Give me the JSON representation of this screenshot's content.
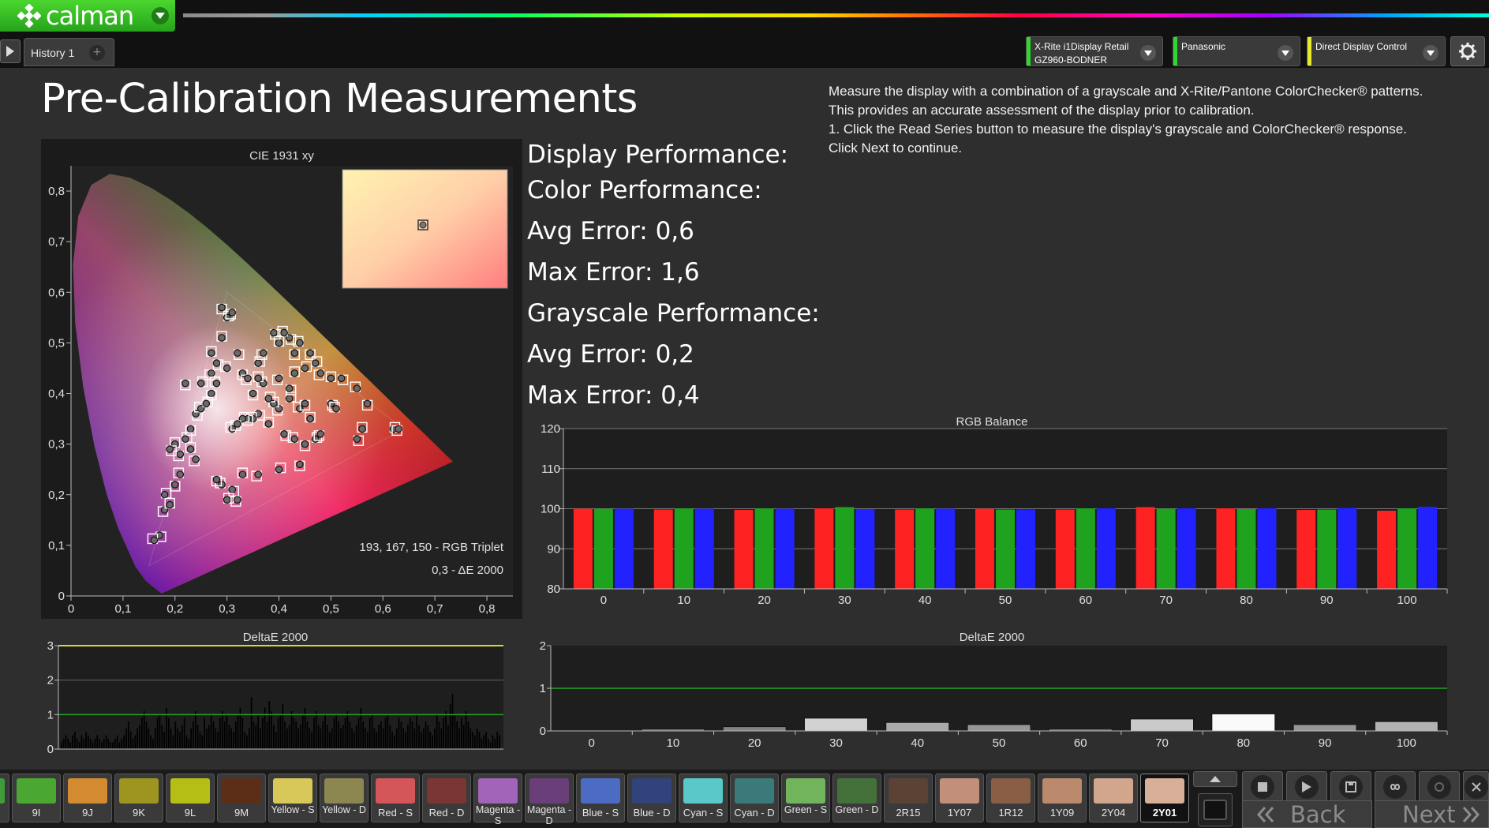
{
  "app": {
    "logo_text": "calman"
  },
  "tabs": {
    "history": "History 1",
    "add": "+"
  },
  "devices": [
    {
      "line1": "X-Rite i1Display Retail",
      "line2": "GZ960-BODNER",
      "status_color": "#2ed62e"
    },
    {
      "line1": "Panasonic",
      "line2": "",
      "status_color": "#2ed62e"
    },
    {
      "line1": "Direct Display Control",
      "line2": "",
      "status_color": "#e8e82a"
    }
  ],
  "page": {
    "title": "Pre-Calibration Measurements",
    "instructions": [
      "Measure the display with a combination of a grayscale and X-Rite/Pantone ColorChecker® patterns.",
      "This provides an accurate assessment of the display prior to calibration.",
      "1. Click the Read Series button to measure the display's grayscale and ColorChecker® response.",
      "Click Next to continue."
    ]
  },
  "stats": {
    "display_performance": "Display Performance:",
    "color_performance": "Color Performance:",
    "color_avg": "Avg Error: 0,6",
    "color_max": "Max Error: 1,6",
    "grayscale_performance": "Grayscale Performance:",
    "gray_avg": "Avg Error: 0,2",
    "gray_max": "Max Error: 0,4"
  },
  "cie": {
    "title": "CIE 1931 xy",
    "x_ticks": [
      "0",
      "0,1",
      "0,2",
      "0,3",
      "0,4",
      "0,5",
      "0,6",
      "0,7",
      "0,8"
    ],
    "y_ticks": [
      "0",
      "0,1",
      "0,2",
      "0,3",
      "0,4",
      "0,5",
      "0,6",
      "0,7",
      "0,8"
    ],
    "readout_rgb": "193, 167, 150 - RGB Triplet",
    "readout_de": "0,3 - ΔE 2000",
    "points": [
      [
        0.31,
        0.33
      ],
      [
        0.29,
        0.57
      ],
      [
        0.3,
        0.55
      ],
      [
        0.31,
        0.56
      ],
      [
        0.27,
        0.48
      ],
      [
        0.28,
        0.46
      ],
      [
        0.3,
        0.45
      ],
      [
        0.33,
        0.44
      ],
      [
        0.36,
        0.46
      ],
      [
        0.37,
        0.48
      ],
      [
        0.4,
        0.5
      ],
      [
        0.42,
        0.51
      ],
      [
        0.44,
        0.5
      ],
      [
        0.46,
        0.48
      ],
      [
        0.47,
        0.46
      ],
      [
        0.48,
        0.44
      ],
      [
        0.5,
        0.43
      ],
      [
        0.52,
        0.43
      ],
      [
        0.55,
        0.41
      ],
      [
        0.57,
        0.38
      ],
      [
        0.62,
        0.33
      ],
      [
        0.63,
        0.33
      ],
      [
        0.56,
        0.33
      ],
      [
        0.55,
        0.31
      ],
      [
        0.44,
        0.37
      ],
      [
        0.45,
        0.38
      ],
      [
        0.42,
        0.39
      ],
      [
        0.4,
        0.37
      ],
      [
        0.39,
        0.38
      ],
      [
        0.36,
        0.36
      ],
      [
        0.35,
        0.35
      ],
      [
        0.34,
        0.35
      ],
      [
        0.33,
        0.35
      ],
      [
        0.32,
        0.34
      ],
      [
        0.38,
        0.34
      ],
      [
        0.41,
        0.32
      ],
      [
        0.43,
        0.31
      ],
      [
        0.45,
        0.3
      ],
      [
        0.47,
        0.31
      ],
      [
        0.48,
        0.32
      ],
      [
        0.46,
        0.35
      ],
      [
        0.5,
        0.38
      ],
      [
        0.51,
        0.37
      ],
      [
        0.44,
        0.26
      ],
      [
        0.4,
        0.25
      ],
      [
        0.36,
        0.24
      ],
      [
        0.33,
        0.24
      ],
      [
        0.31,
        0.21
      ],
      [
        0.29,
        0.22
      ],
      [
        0.28,
        0.23
      ],
      [
        0.3,
        0.19
      ],
      [
        0.24,
        0.27
      ],
      [
        0.23,
        0.29
      ],
      [
        0.24,
        0.36
      ],
      [
        0.25,
        0.37
      ],
      [
        0.23,
        0.33
      ],
      [
        0.22,
        0.31
      ],
      [
        0.21,
        0.28
      ],
      [
        0.2,
        0.3
      ],
      [
        0.19,
        0.29
      ],
      [
        0.21,
        0.24
      ],
      [
        0.2,
        0.22
      ],
      [
        0.18,
        0.2
      ],
      [
        0.18,
        0.17
      ],
      [
        0.19,
        0.18
      ],
      [
        0.17,
        0.12
      ],
      [
        0.16,
        0.11
      ],
      [
        0.22,
        0.42
      ],
      [
        0.25,
        0.42
      ],
      [
        0.27,
        0.44
      ],
      [
        0.29,
        0.51
      ],
      [
        0.32,
        0.48
      ],
      [
        0.28,
        0.42
      ],
      [
        0.27,
        0.4
      ],
      [
        0.26,
        0.38
      ],
      [
        0.4,
        0.43
      ],
      [
        0.43,
        0.44
      ],
      [
        0.42,
        0.41
      ],
      [
        0.37,
        0.42
      ],
      [
        0.35,
        0.4
      ],
      [
        0.38,
        0.39
      ],
      [
        0.34,
        0.43
      ],
      [
        0.36,
        0.43
      ],
      [
        0.39,
        0.52
      ],
      [
        0.41,
        0.52
      ],
      [
        0.43,
        0.48
      ],
      [
        0.45,
        0.45
      ],
      [
        0.32,
        0.19
      ]
    ]
  },
  "rgb_balance": {
    "title": "RGB Balance",
    "categories": [
      "0",
      "10",
      "20",
      "30",
      "40",
      "50",
      "60",
      "70",
      "80",
      "90",
      "100"
    ],
    "y_ticks": [
      "80",
      "90",
      "100",
      "110",
      "120"
    ],
    "ylim": [
      80,
      120
    ],
    "red": [
      100.0,
      99.8,
      99.7,
      100.1,
      99.8,
      100.0,
      99.8,
      100.4,
      100.1,
      99.7,
      99.5
    ],
    "green": [
      100.0,
      100.1,
      100.1,
      100.4,
      100.1,
      99.8,
      100.1,
      100.0,
      99.9,
      99.8,
      100.1
    ],
    "blue": [
      100.0,
      100.0,
      100.0,
      99.9,
      100.0,
      99.8,
      100.1,
      100.1,
      100.1,
      100.2,
      100.5
    ],
    "colors": {
      "red": "#ff2222",
      "green": "#1fa31f",
      "blue": "#2222ff"
    }
  },
  "deltae_color": {
    "title": "DeltaE 2000",
    "y_ticks": [
      "0",
      "1",
      "2",
      "3"
    ],
    "ylim": [
      0,
      3
    ],
    "threshold": 1,
    "max_line": 3,
    "values": [
      0.2,
      0.3,
      0.4,
      0.3,
      0.2,
      0.4,
      0.5,
      0.3,
      0.2,
      0.4,
      0.3,
      0.5,
      0.4,
      0.3,
      0.2,
      0.3,
      0.4,
      0.3,
      0.2,
      0.3,
      0.4,
      0.3,
      0.2,
      0.2,
      0.3,
      0.4,
      0.2,
      0.3,
      0.4,
      0.6,
      0.8,
      0.5,
      0.3,
      0.4,
      0.6,
      0.7,
      0.9,
      1.1,
      0.8,
      0.6,
      0.4,
      0.3,
      0.6,
      0.9,
      1.0,
      0.7,
      0.5,
      1.2,
      0.9,
      0.6,
      0.4,
      0.8,
      0.6,
      0.5,
      0.7,
      0.9,
      0.4,
      0.3,
      0.6,
      0.8,
      1.1,
      0.7,
      0.5,
      0.4,
      0.9,
      0.6,
      0.7,
      1.0,
      0.8,
      0.6,
      0.5,
      0.9,
      1.1,
      0.8,
      1.0,
      0.7,
      0.6,
      0.5,
      0.8,
      1.0,
      1.2,
      0.9,
      0.5,
      0.4,
      0.6,
      1.5,
      0.8,
      0.7,
      1.0,
      0.6,
      0.9,
      1.2,
      0.8,
      1.4,
      1.1,
      0.7,
      0.5,
      0.9,
      1.0,
      1.3,
      0.8,
      0.6,
      0.7,
      1.1,
      0.9,
      0.8,
      0.6,
      0.7,
      1.0,
      1.2,
      0.8,
      0.6,
      0.5,
      0.9,
      1.1,
      0.7,
      0.6,
      0.8,
      1.0,
      0.7,
      0.5,
      0.6,
      0.9,
      1.0,
      0.8,
      0.6,
      0.7,
      0.9,
      1.1,
      0.8,
      0.6,
      0.5,
      0.7,
      0.9,
      1.2,
      0.8,
      0.6,
      0.5,
      0.9,
      1.0,
      0.6,
      0.5,
      0.7,
      0.8,
      0.6,
      0.9,
      1.0,
      0.7,
      0.5,
      0.4,
      0.6,
      0.9,
      0.8,
      0.6,
      0.5,
      0.7,
      0.9,
      0.8,
      0.6,
      1.0,
      0.7,
      0.5,
      0.6,
      0.8,
      0.7,
      0.5,
      0.4,
      0.6,
      1.0,
      0.8,
      0.6,
      0.9,
      1.1,
      0.7,
      1.3,
      1.6,
      1.0,
      0.8,
      0.6,
      0.9,
      0.7,
      1.1,
      0.8,
      0.6,
      0.5,
      0.4,
      0.6,
      0.5,
      0.3,
      0.4,
      0.5,
      0.3,
      0.2,
      0.4,
      0.3,
      0.5,
      0.4
    ]
  },
  "deltae_gray": {
    "title": "DeltaE 2000",
    "categories": [
      "0",
      "10",
      "20",
      "30",
      "40",
      "50",
      "60",
      "70",
      "80",
      "90",
      "100"
    ],
    "y_ticks": [
      "0",
      "1",
      "2"
    ],
    "ylim": [
      0,
      2
    ],
    "threshold": 1,
    "values": [
      0.0,
      0.05,
      0.1,
      0.3,
      0.2,
      0.15,
      0.05,
      0.28,
      0.4,
      0.15,
      0.22
    ]
  },
  "swatches": [
    {
      "label": "",
      "color": "#3f9c3a"
    },
    {
      "label": "9I",
      "color": "#4aa832"
    },
    {
      "label": "9J",
      "color": "#d48a30"
    },
    {
      "label": "9K",
      "color": "#9e9420"
    },
    {
      "label": "9L",
      "color": "#b4be14"
    },
    {
      "label": "9M",
      "color": "#5c2e18"
    },
    {
      "label": "Yellow - S",
      "color": "#d8c85a"
    },
    {
      "label": "Yellow - D",
      "color": "#8c8650"
    },
    {
      "label": "Red - S",
      "color": "#d45658"
    },
    {
      "label": "Red - D",
      "color": "#7a3634"
    },
    {
      "label": "Magenta - S",
      "color": "#a264b8"
    },
    {
      "label": "Magenta - D",
      "color": "#6a3e78"
    },
    {
      "label": "Blue - S",
      "color": "#4c6cc4"
    },
    {
      "label": "Blue - D",
      "color": "#31437a"
    },
    {
      "label": "Cyan - S",
      "color": "#5ac8c8"
    },
    {
      "label": "Cyan - D",
      "color": "#3a7a7a"
    },
    {
      "label": "Green - S",
      "color": "#72b45c"
    },
    {
      "label": "Green - D",
      "color": "#44703a"
    },
    {
      "label": "2R15",
      "color": "#5a4234"
    },
    {
      "label": "1Y07",
      "color": "#c2907a"
    },
    {
      "label": "1R12",
      "color": "#8a5e44"
    },
    {
      "label": "1Y09",
      "color": "#bb8a6c"
    },
    {
      "label": "2Y04",
      "color": "#d2a68c"
    },
    {
      "label": "2Y01",
      "color": "#d8b09a"
    }
  ],
  "nav": {
    "back": "Back",
    "next": "Next"
  }
}
